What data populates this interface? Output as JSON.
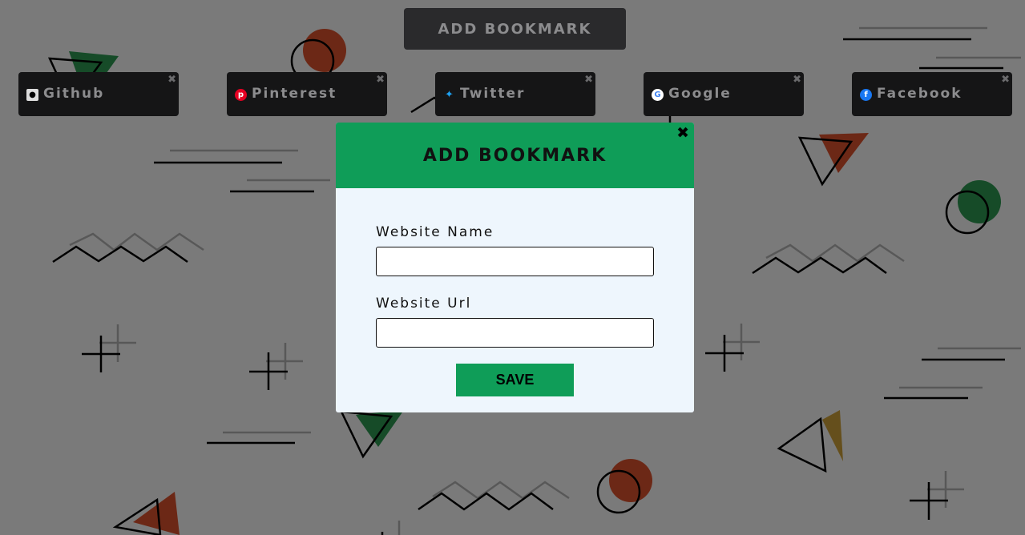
{
  "header": {
    "add_bookmark_label": "ADD BOOKMARK"
  },
  "bookmarks": [
    {
      "name": "Github",
      "icon": "github-icon",
      "icon_color": "#dddddd"
    },
    {
      "name": "Pinterest",
      "icon": "pinterest-icon",
      "icon_color": "#e60023"
    },
    {
      "name": "Twitter",
      "icon": "twitter-icon",
      "icon_color": "#1da1f2"
    },
    {
      "name": "Google",
      "icon": "google-icon",
      "icon_color": "#ffffff"
    },
    {
      "name": "Facebook",
      "icon": "facebook-icon",
      "icon_color": "#1877f2"
    }
  ],
  "modal": {
    "title": "ADD BOOKMARK",
    "name_label": "Website Name",
    "name_value": "",
    "url_label": "Website Url",
    "url_value": "",
    "save_label": "SAVE"
  },
  "colors": {
    "accent": "#0f9d58",
    "modal_bg": "#eef6fd",
    "overlay": "rgba(0,0,0,0.52)"
  }
}
